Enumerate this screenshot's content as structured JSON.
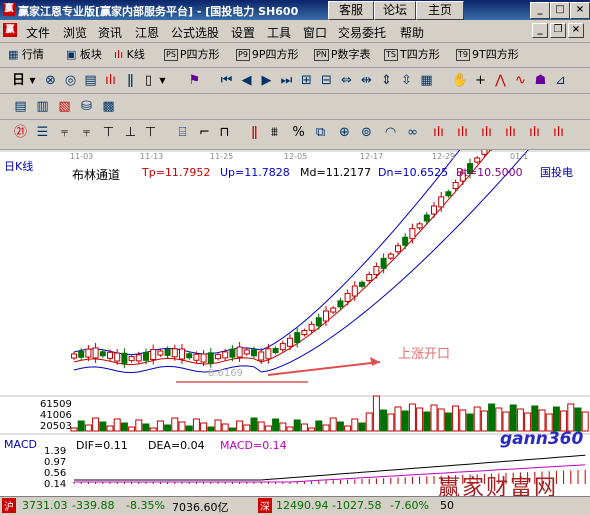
{
  "window": {
    "title": "赢家江恩专业版[赢家内部服务平台] - [国投电力  SH600",
    "links": [
      "客服",
      "论坛",
      "主页"
    ]
  },
  "menu": [
    "文件",
    "浏览",
    "资讯",
    "江恩",
    "公式选股",
    "设置",
    "工具",
    "窗口",
    "交易委托",
    "帮助"
  ],
  "toolbar1": [
    {
      "icon": "grid-icon",
      "label": "行情"
    },
    {
      "icon": "block-icon",
      "label": "板块"
    },
    {
      "icon": "candle-icon",
      "label": "K线"
    },
    {
      "tag": "PS",
      "label": "P四方形"
    },
    {
      "tag": "P9",
      "label": "9P四方形"
    },
    {
      "tag": "PN",
      "label": "P数字表"
    },
    {
      "tag": "TS",
      "label": "T四方形"
    },
    {
      "tag": "T9",
      "label": "9T四方形"
    }
  ],
  "chart": {
    "panel_label": "日K线",
    "indicator_name": "布林通道",
    "tp": "Tp=11.7952",
    "up": "Up=11.7828",
    "md": "Md=11.2177",
    "dn": "Dn=10.6525",
    "bt": "Bt=10.5000",
    "stock_name": "国投电",
    "dates": [
      "11-03",
      "11-13",
      "11-25",
      "12-05",
      "12-17",
      "12-29",
      "01-1"
    ],
    "annotation": "上涨开口",
    "low_label": "8.6169",
    "volume_ticks": [
      "61509",
      "41006",
      "20503"
    ],
    "macd_label": "MACD",
    "dif": "DIF=0.11",
    "dea": "DEA=0.04",
    "macd": "MACD=0.14",
    "macd_ticks": [
      "1.39",
      "0.97",
      "0.56",
      "0.14"
    ],
    "watermark_logo": "gann360",
    "watermark_text": "赢家财富网"
  },
  "status": {
    "sh_badge": "沪",
    "sh_index": "3731.03",
    "sh_change": "-339.88",
    "sh_pct": "-8.35%",
    "sh_amount": "7036.60亿",
    "sz_badge": "深",
    "sz_index": "12490.94",
    "sz_change": "-1027.58",
    "sz_pct": "-7.60%",
    "sz_amount": "50"
  }
}
